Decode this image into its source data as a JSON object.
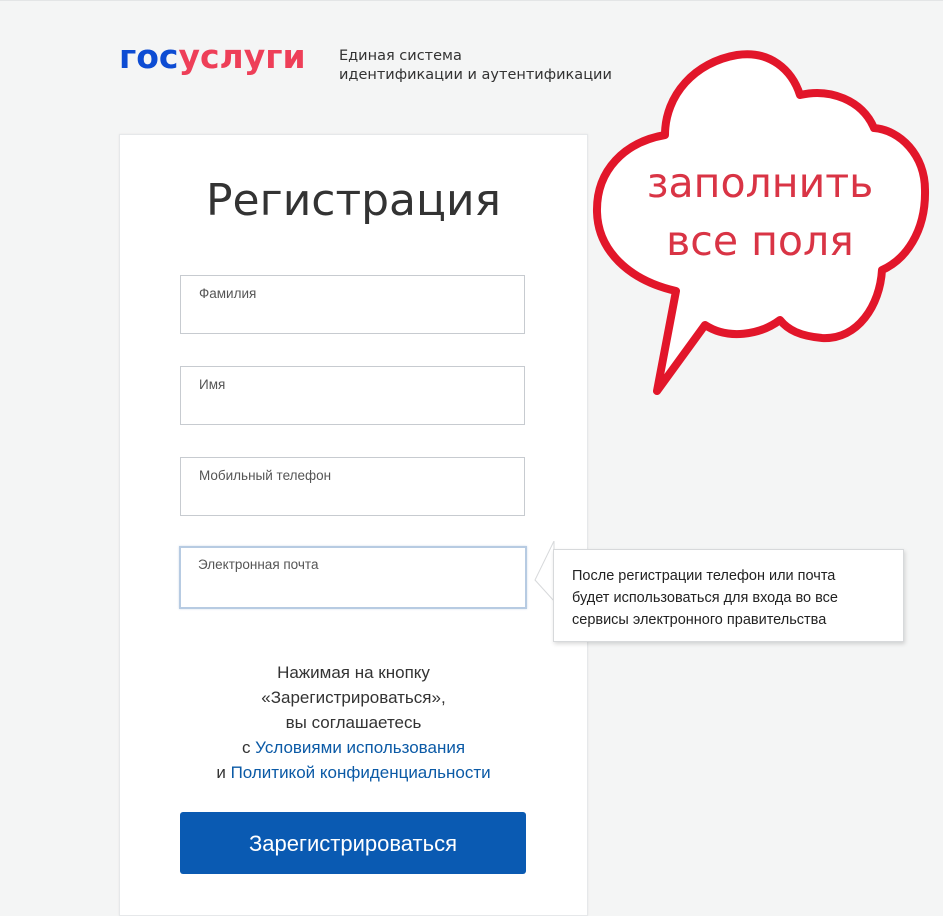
{
  "header": {
    "logo_part1": "гос",
    "logo_part2": "услуги",
    "subtitle_line1": "Единая система",
    "subtitle_line2": "идентификации и аутентификации"
  },
  "form": {
    "title": "Регистрация",
    "fields": [
      {
        "placeholder": "Фамилия",
        "value": ""
      },
      {
        "placeholder": "Имя",
        "value": ""
      },
      {
        "placeholder": "Мобильный телефон",
        "value": ""
      },
      {
        "placeholder": "Электронная почта",
        "value": "",
        "focused": true
      }
    ],
    "agreement": {
      "line1": "Нажимая на кнопку",
      "line2": "«Зарегистрироваться»,",
      "line3": "вы соглашаетесь",
      "prefix1": "с ",
      "terms_link": "Условиями использования",
      "prefix2": "и ",
      "privacy_link": "Политикой конфиденциальности"
    },
    "submit_label": "Зарегистрироваться"
  },
  "tooltip": {
    "text_line1": "После регистрации телефон или почта",
    "text_line2": "будет использоваться для входа во все",
    "text_line3": "сервисы электронного правительства"
  },
  "annotation": {
    "line1": "заполнить",
    "line2": "все поля",
    "color": "#d93445"
  },
  "colors": {
    "brand_blue": "#0d4cd3",
    "brand_red": "#ee3f58",
    "button": "#0a5ab2",
    "link": "#0b5aa6"
  }
}
